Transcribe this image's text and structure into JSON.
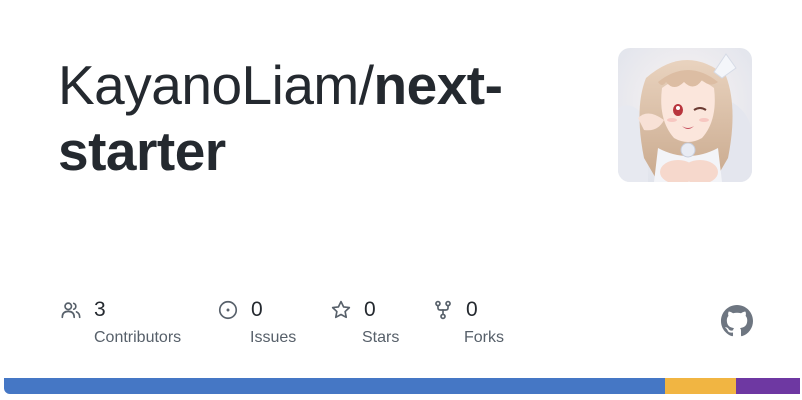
{
  "repo": {
    "owner_prefix": "KayanoLiam/",
    "name": "next-starter"
  },
  "stats": [
    {
      "count": "3",
      "label": "Contributors",
      "icon": "people-icon"
    },
    {
      "count": "0",
      "label": "Issues",
      "icon": "issue-opened-icon"
    },
    {
      "count": "0",
      "label": "Stars",
      "icon": "star-icon"
    },
    {
      "count": "0",
      "label": "Forks",
      "icon": "repo-forked-icon"
    }
  ],
  "avatar_icon": "anime-character-avatar",
  "brand_icon": "github-mark-icon",
  "language_bar": [
    {
      "share": 0.83,
      "color": "#4577c5"
    },
    {
      "share": 0.09,
      "color": "#f1b542"
    },
    {
      "share": 0.08,
      "color": "#6e38a2"
    }
  ],
  "colors": {
    "text_primary": "#24292f",
    "text_secondary": "#57606a",
    "icon": "#57606a"
  }
}
